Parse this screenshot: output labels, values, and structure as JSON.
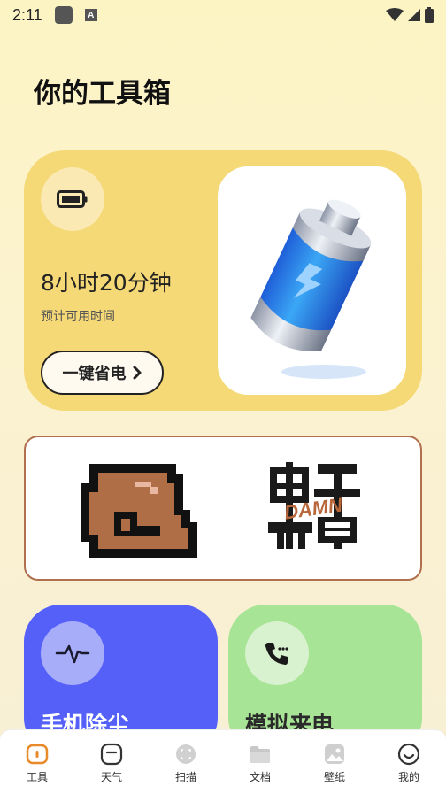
{
  "status_bar": {
    "time": "2:11"
  },
  "page_title": "你的工具箱",
  "battery_card": {
    "remaining_time": "8小时20分钟",
    "subtitle": "预计可用时间",
    "button_label": "一键省电"
  },
  "banner": {
    "brand_text": "DAMN"
  },
  "tiles": [
    {
      "label": "手机除尘",
      "icon": "pulse-icon"
    },
    {
      "label": "模拟来电",
      "icon": "phone-icon"
    }
  ],
  "bottom_nav": {
    "items": [
      {
        "label": "工具",
        "icon": "toolbox-icon",
        "active": true
      },
      {
        "label": "天气",
        "icon": "weather-icon",
        "active": false
      },
      {
        "label": "扫描",
        "icon": "scan-icon",
        "active": false
      },
      {
        "label": "文档",
        "icon": "folder-icon",
        "active": false
      },
      {
        "label": "壁纸",
        "icon": "wallpaper-icon",
        "active": false
      },
      {
        "label": "我的",
        "icon": "smile-icon",
        "active": false
      }
    ]
  },
  "colors": {
    "card_yellow": "#f5d976",
    "tile_blue": "#5560f8",
    "tile_green": "#a8e495",
    "accent_orange": "#e8892a"
  }
}
